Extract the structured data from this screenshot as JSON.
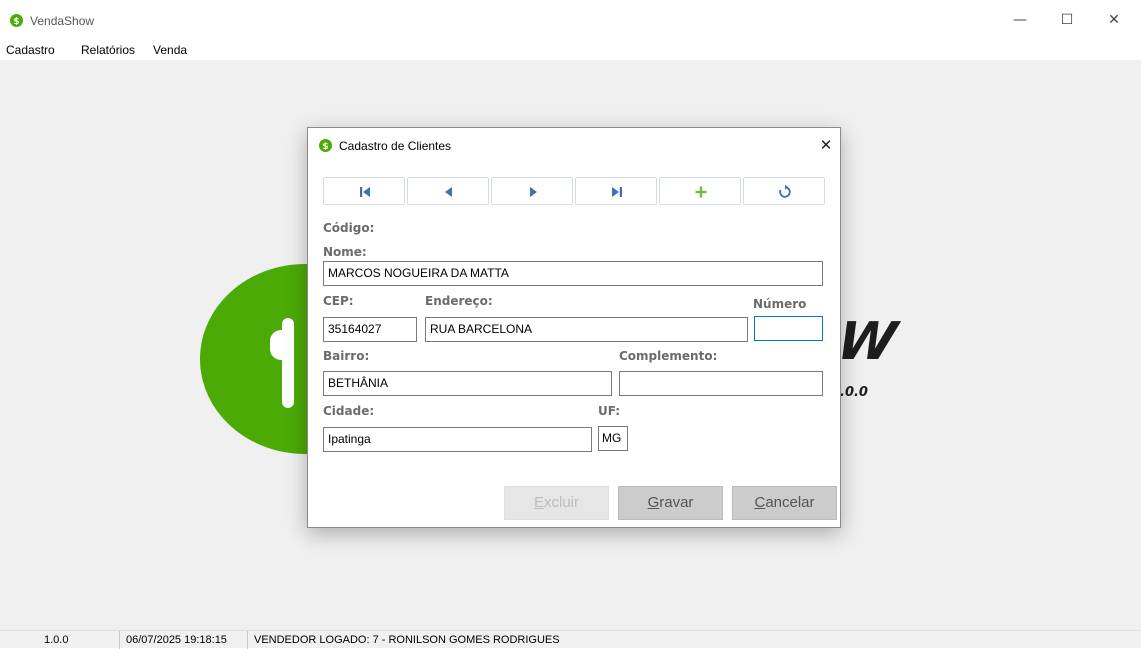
{
  "app": {
    "title": "VendaShow",
    "icon": "dollar-circle-icon",
    "accent": "#4caa06"
  },
  "window_controls": {
    "minimize": "—",
    "maximize": "☐",
    "close": "✕"
  },
  "menu": [
    "Cadastro",
    "Relatórios",
    "Venda"
  ],
  "logo": {
    "letters": "W",
    "version": ".0.0"
  },
  "dialog": {
    "title": "Cadastro de Clientes",
    "close": "✕",
    "nav_buttons": [
      "first-record-icon",
      "previous-record-icon",
      "next-record-icon",
      "last-record-icon",
      "add-record-icon",
      "refresh-icon"
    ],
    "labels": {
      "codigo": "Código:",
      "nome": "Nome:",
      "cep": "CEP:",
      "endereco": "Endereço:",
      "numero": "Número",
      "bairro": "Bairro:",
      "complemento": "Complemento:",
      "cidade": "Cidade:",
      "uf": "UF:"
    },
    "values": {
      "nome": "MARCOS NOGUEIRA DA MATTA",
      "cep": "35164027",
      "endereco": "RUA BARCELONA",
      "numero": "",
      "bairro": "BETHÂNIA",
      "complemento": "",
      "cidade": "Ipatinga",
      "uf": "MG"
    },
    "buttons": {
      "excluir": {
        "first": "E",
        "rest": "xcluir"
      },
      "gravar": {
        "first": "G",
        "rest": "ravar"
      },
      "cancelar": {
        "first": "C",
        "rest": "ancelar"
      }
    }
  },
  "status": {
    "version": "1.0.0",
    "datetime": "06/07/2025 19:18:15",
    "vendedor": "VENDEDOR LOGADO:  7 - RONILSON GOMES RODRIGUES"
  }
}
